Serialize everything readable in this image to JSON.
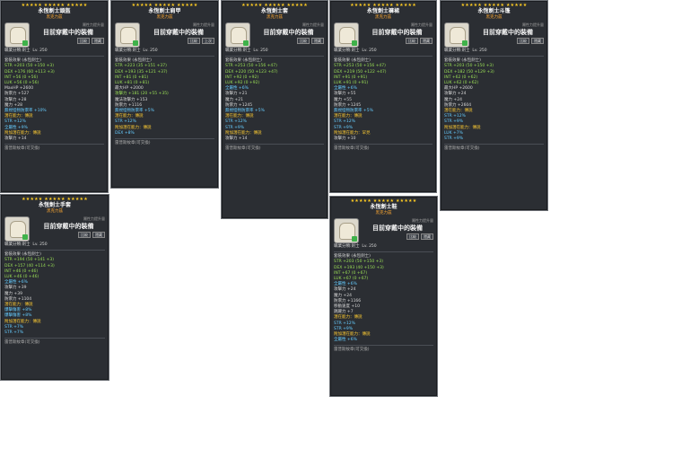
{
  "tooltips": [
    {
      "id": "hat",
      "title": "永恆劍士頭盔",
      "subtitle": "黑克力茲",
      "left": "職業分類:劍士",
      "level": "Lv. 250",
      "hint": "屬性力提升量",
      "equipped": "目前穿戴中的裝備",
      "btn1": "比較",
      "btn2": "隱藏",
      "lines": [
        "套裝效果 (永恆劍士)",
        "STR +203 (50 +150 +3)",
        "DEX +176 (60 +113 +3)",
        "INT +56 (0 +56)",
        "LUK +56 (0 +56)",
        "MaxHP +2600",
        "防禦力 +527",
        "攻擊力 +28",
        "魔力 +28",
        "無視怪物防禦率 +10%",
        "潛在能力：傳說",
        "STR +12%",
        "全屬性 +9%",
        "附加潛在能力：傳說",
        "攻擊力 +14"
      ],
      "foot": "雷普斯紋章(可交換)"
    },
    {
      "id": "shoulder",
      "title": "永恆劍士肩甲",
      "subtitle": "黑克力茲",
      "left": "職業分類:劍士",
      "level": "Lv. 250",
      "hint": "屬性力提升量",
      "equipped": "目前穿戴中的裝備",
      "btn1": "比較",
      "btn2": "上次",
      "lines": [
        "套裝效果 (永恆劍士)",
        "STR +223 (35 +151 +37)",
        "DEX +193 (35 +121 +37)",
        "INT +81 (0 +81)",
        "LUK +81 (0 +81)",
        "最大HP +2000",
        "攻擊力 +181 (20 +55 +35)",
        "魔法攻擊力 +153",
        "防禦力 +1116",
        "無視怪物防禦率 +5%",
        "潛在能力：傳說",
        "STR +12%",
        "附加潛在能力：傳說",
        "DEX +8%"
      ],
      "foot": "雷普斯紋章(可交換)"
    },
    {
      "id": "top",
      "title": "永恆劍士套",
      "subtitle": "黑克力茲",
      "left": "職業分類:劍士",
      "level": "Lv. 250",
      "hint": "屬性力提升量",
      "equipped": "目前穿戴中的裝備",
      "btn1": "比較",
      "btn2": "隱藏",
      "lines": [
        "套裝效果 (永恆劍士)",
        "STR +253 (50 +156 +47)",
        "DEX +220 (50 +123 +47)",
        "INT +92 (0 +92)",
        "LUK +92 (0 +92)",
        "全屬性 +6%",
        "攻擊力 +21",
        "魔力 +21",
        "防禦力 +1245",
        "無視怪物防禦率 +5%",
        "潛在能力：傳說",
        "STR +12%",
        "STR +9%",
        "附加潛在能力：傳說",
        "攻擊力 +14"
      ],
      "foot": "雷普斯紋章(可交換)"
    },
    {
      "id": "bottom",
      "title": "永恆劍士褲裙",
      "subtitle": "黑克力茲",
      "left": "職業分類:劍士",
      "level": "Lv. 250",
      "hint": "屬性力提升量",
      "equipped": "目前穿戴中的裝備",
      "btn1": "比較",
      "btn2": "隱藏",
      "lines": [
        "套裝效果 (永恆劍士)",
        "STR +253 (50 +156 +47)",
        "DEX +219 (50 +122 +47)",
        "INT +91 (0 +91)",
        "LUK +91 (0 +91)",
        "全屬性 +6%",
        "攻擊力 +55",
        "魔力 +55",
        "防禦力 +1245",
        "無視怪物防禦率 +5%",
        "潛在能力：傳說",
        "STR +12%",
        "STR +9%",
        "附加潛在能力：罕見",
        "攻擊力 +10"
      ],
      "foot": "雷普斯紋章(可交換)"
    },
    {
      "id": "cape",
      "title": "永恆劍士斗篷",
      "subtitle": "黑克力茲",
      "left": "職業分類:劍士",
      "level": "Lv. 250",
      "hint": "屬性力提升量",
      "equipped": "目前穿戴中的裝備",
      "btn1": "比較",
      "btn2": "隱藏",
      "lines": [
        "套裝效果 (永恆劍士)",
        "STR +203 (50 +150 +3)",
        "DEX +182 (50 +129 +3)",
        "INT +62 (0 +62)",
        "LUK +62 (0 +62)",
        "最大HP +2600",
        "攻擊力 +24",
        "魔力 +24",
        "防禦力 +2604",
        "潛在能力：傳說",
        "STR +12%",
        "STR +9%",
        "附加潛在能力：傳說",
        "LUK +7%",
        "STR +9%"
      ],
      "foot": "雷普斯紋章(可交換)"
    },
    {
      "id": "glove",
      "title": "永恆劍士手套",
      "subtitle": "黑克力茲",
      "left": "職業分類:劍士",
      "level": "Lv. 250",
      "hint": "屬性力提升量",
      "equipped": "目前穿戴中的裝備",
      "btn1": "比較",
      "btn2": "隱藏",
      "lines": [
        "套裝效果 (永恆劍士)",
        "STR +194 (50 +141 +3)",
        "DEX +157 (40 +114 +3)",
        "INT +46 (0 +46)",
        "LUK +46 (0 +46)",
        "全屬性 +6%",
        "攻擊力 +39",
        "魔力 +39",
        "防禦力 +1104",
        "潛在能力：傳說",
        "爆擊傷害 +8%",
        "爆擊傷害 +8%",
        "附加潛在能力：傳說",
        "STR +7%",
        "STR +7%"
      ],
      "foot": "雷普斯紋章(可交換)"
    },
    {
      "id": "shoe",
      "title": "永恆劍士鞋",
      "subtitle": "黑克力茲",
      "left": "職業分類:劍士",
      "level": "Lv. 250",
      "hint": "屬性力提升量",
      "equipped": "目前穿戴中的裝備",
      "btn1": "比較",
      "btn2": "隱藏",
      "lines": [
        "套裝效果 (永恆劍士)",
        "STR +203 (50 +150 +3)",
        "DEX +193 (40 +150 +3)",
        "INT +67 (0 +67)",
        "LUK +67 (0 +67)",
        "全屬性 +6%",
        "攻擊力 +24",
        "魔力 +24",
        "防禦力 +1166",
        "移動速度 +10",
        "跳躍力 +7",
        "潛在能力：傳說",
        "STR +12%",
        "STR +9%",
        "附加潛在能力：傳說",
        "全屬性 +6%"
      ],
      "foot": "雷普斯紋章(可交換)"
    }
  ]
}
